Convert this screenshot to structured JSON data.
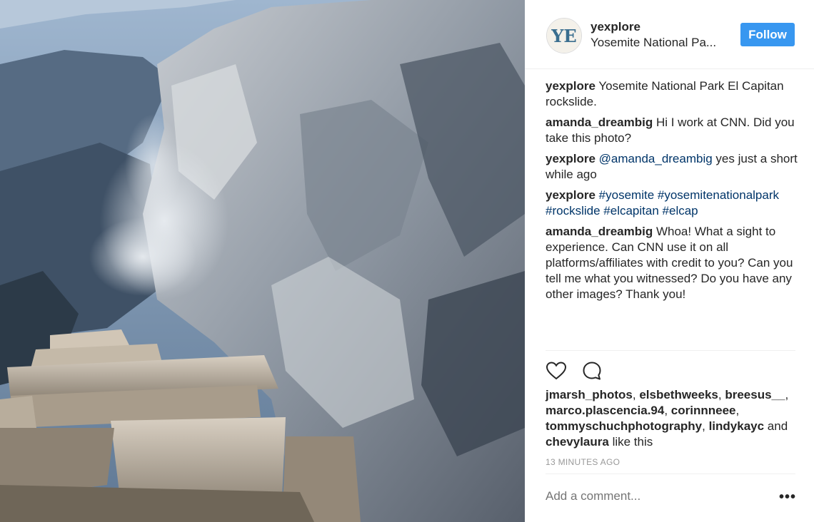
{
  "header": {
    "username": "yexplore",
    "location": "Yosemite National Pa...",
    "follow_label": "Follow",
    "avatar_text": "YE"
  },
  "comments": [
    {
      "user": "yexplore",
      "text": " Yosemite National Park El Capitan rockslide."
    },
    {
      "user": "amanda_dreambig",
      "text": " Hi I work at CNN. Did you take this photo?"
    },
    {
      "user": "yexplore",
      "mention": "@amanda_dreambig",
      "text": " yes just a short while ago"
    },
    {
      "user": "yexplore",
      "hashtags": [
        "#yosemite",
        "#yosemitenationalpark",
        "#rockslide",
        "#elcapitan",
        "#elcap"
      ]
    },
    {
      "user": "amanda_dreambig",
      "text": " Whoa! What a sight to experience. Can CNN use it on all platforms/affiliates with credit to you? Can you tell me what you witnessed? Do you have any other images? Thank you!"
    }
  ],
  "likes": {
    "users": [
      "jmarsh_photos",
      "elsbethweeks",
      "breesus__",
      "marco.plascencia.94",
      "corinnneee",
      "tommyschuchphotography",
      "lindykayc",
      "chevylaura"
    ],
    "and_text": " and ",
    "suffix": " like this"
  },
  "timestamp": "13 MINUTES AGO",
  "add_comment_placeholder": "Add a comment...",
  "more_label": "•••",
  "icons": {
    "like": "heart-icon",
    "comment": "comment-icon",
    "more": "more-options-icon"
  },
  "colors": {
    "accent": "#3897f0",
    "link": "#003569",
    "muted": "#999999",
    "text": "#262626"
  }
}
